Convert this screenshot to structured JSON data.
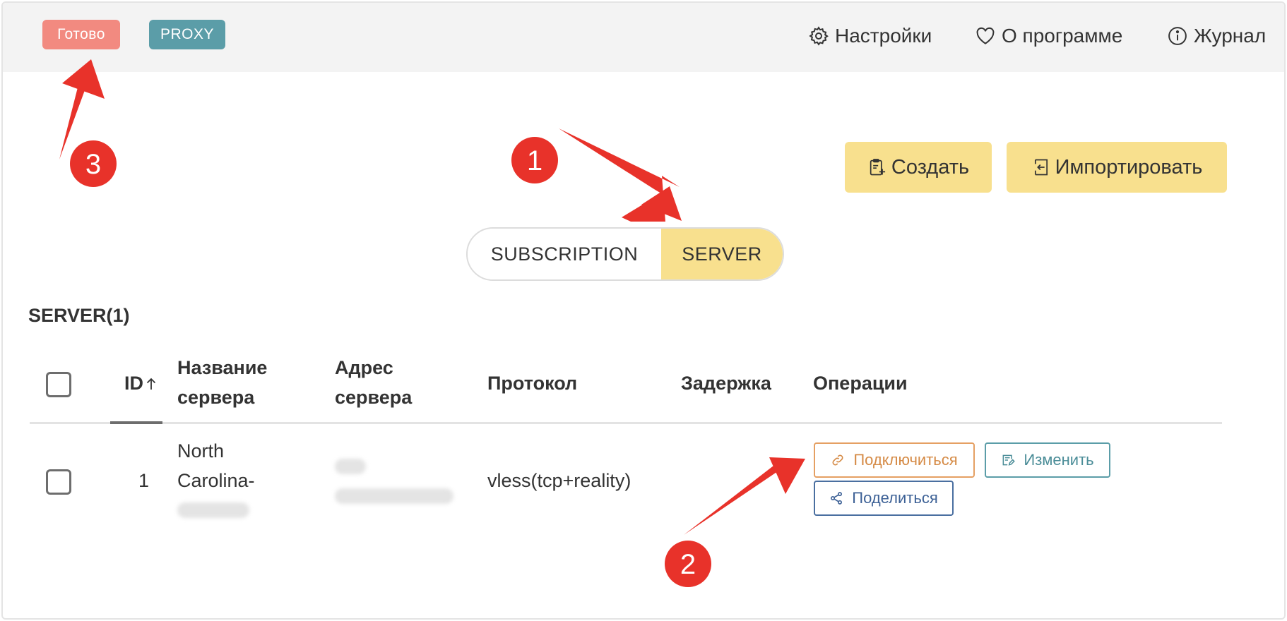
{
  "topbar": {
    "status_label": "Готово",
    "mode_label": "PROXY",
    "nav": {
      "settings": "Настройки",
      "about": "О программе",
      "log": "Журнал"
    }
  },
  "toolbar": {
    "create_label": "Создать",
    "import_label": "Импортировать"
  },
  "segment": {
    "subscription_label": "SUBSCRIPTION",
    "server_label": "SERVER",
    "active": "SERVER"
  },
  "section": {
    "title": "SERVER(1)"
  },
  "table": {
    "headers": {
      "id": "ID",
      "name_line1": "Название",
      "name_line2": "сервера",
      "address_line1": "Адрес",
      "address_line2": "сервера",
      "protocol": "Протокол",
      "latency": "Задержка",
      "operations": "Операции"
    },
    "rows": [
      {
        "id": "1",
        "name_line1": "North",
        "name_line2": "Carolina-",
        "protocol": "vless(tcp+reality)",
        "latency": ""
      }
    ],
    "operations": {
      "connect": "Подключиться",
      "edit": "Изменить",
      "share": "Поделиться"
    }
  },
  "annotations": {
    "marker_1": "1",
    "marker_2": "2",
    "marker_3": "3",
    "marker_color": "#e8322a"
  },
  "colors": {
    "ready": "#f28a80",
    "proxy": "#5b9da8",
    "accent_yellow": "#f8e08e",
    "connect": "#e5a063",
    "edit": "#5b9da8",
    "share": "#4a6fa0"
  }
}
